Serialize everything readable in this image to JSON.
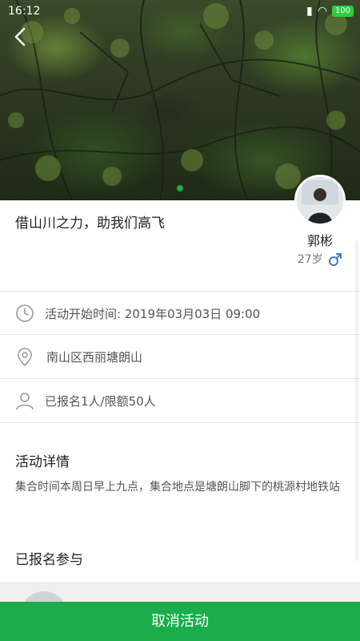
{
  "status_bar": {
    "time": "16:12",
    "battery": "100"
  },
  "hero": {
    "page_indicator_count": 1
  },
  "activity": {
    "title": "借山川之力，助我们高飞",
    "start_time_label": "活动开始时间: 2019年03月03日 09:00",
    "location": "南山区西丽塘朗山",
    "signup_status": "已报名1人/限额50人"
  },
  "host": {
    "name": "郭彬",
    "age": "27岁",
    "gender_icon": "male-icon"
  },
  "details": {
    "heading": "活动详情",
    "text": "集合时间本周日早上九点，集合地点是塘朗山脚下的桃源村地铁站"
  },
  "participants": {
    "heading": "已报名参与"
  },
  "actions": {
    "cancel_label": "取消活动"
  },
  "colors": {
    "accent": "#1aad4a",
    "divider": "#e8e8e8"
  }
}
